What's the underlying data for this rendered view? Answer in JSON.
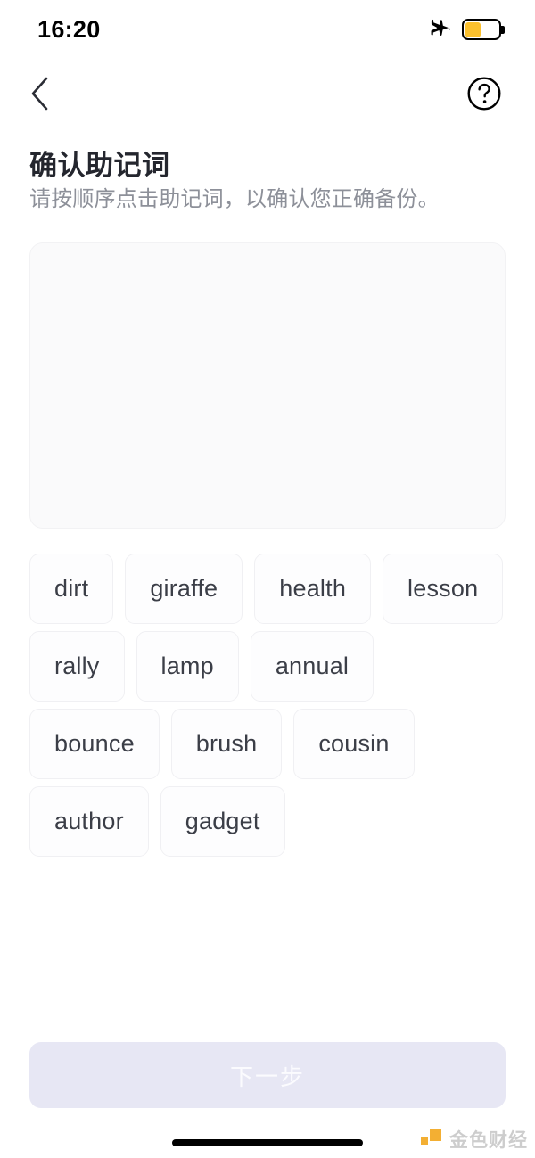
{
  "status_bar": {
    "time": "16:20",
    "airplane_icon": "airplane-mode-icon",
    "battery_icon": "battery-low-power-icon",
    "battery_level_percent": 45,
    "battery_color": "#fbc02d"
  },
  "nav_bar": {
    "back_icon": "chevron-left-icon",
    "help_icon": "question-circle-icon"
  },
  "header": {
    "title": "确认助记词",
    "subtitle": "请按顺序点击助记词，以确认您正确备份。"
  },
  "selection_panel": {
    "selected_words": [],
    "background_color": "#fafafb"
  },
  "word_bank": {
    "words": [
      "dirt",
      "giraffe",
      "health",
      "lesson",
      "rally",
      "lamp",
      "annual",
      "bounce",
      "brush",
      "cousin",
      "author",
      "gadget"
    ]
  },
  "footer": {
    "next_label": "下一步",
    "next_enabled": false,
    "next_background_color": "#e7e7f4"
  },
  "watermark": {
    "text": "金色财经",
    "logo_icon": "jinse-logo-icon",
    "logo_color": "#f2a922"
  }
}
